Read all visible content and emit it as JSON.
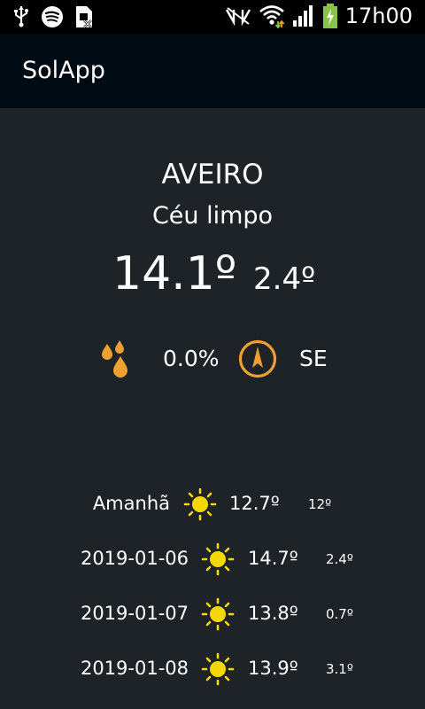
{
  "status_bar": {
    "time": "17h00",
    "icons": [
      "usb-icon",
      "spotify-icon",
      "no-sim-icon",
      "nfc-icon",
      "wifi-icon",
      "signal-icon",
      "battery-charging-icon"
    ]
  },
  "app": {
    "title": "SolApp"
  },
  "current": {
    "city": "AVEIRO",
    "condition": "Céu limpo",
    "temp_max": "14.1º",
    "temp_min": "2.4º",
    "precipitation": "0.0%",
    "wind_direction": "SE"
  },
  "forecast": [
    {
      "label": "Amanhã",
      "max": "12.7º",
      "min": "12º",
      "icon": "sun-icon"
    },
    {
      "label": "2019-01-06",
      "max": "14.7º",
      "min": "2.4º",
      "icon": "sun-icon"
    },
    {
      "label": "2019-01-07",
      "max": "13.8º",
      "min": "0.7º",
      "icon": "sun-icon"
    },
    {
      "label": "2019-01-08",
      "max": "13.9º",
      "min": "3.1º",
      "icon": "sun-icon"
    }
  ],
  "colors": {
    "background": "#1e2328",
    "app_bar": "#000b14",
    "accent_orange": "#f0a030",
    "sun_yellow": "#f5d800",
    "battery_green": "#8bc34a"
  }
}
